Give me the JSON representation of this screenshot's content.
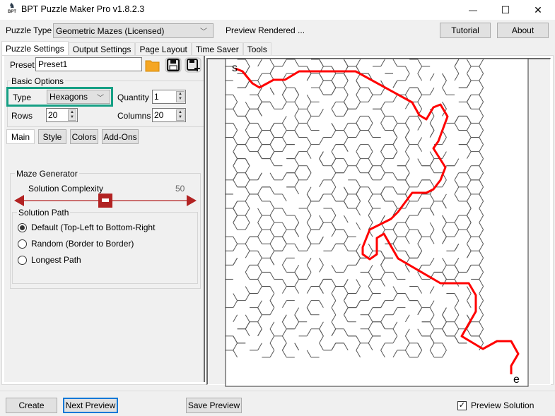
{
  "window": {
    "title": "BPT Puzzle Maker Pro v1.8.2.3",
    "app_icon_text": "BPT",
    "controls": {
      "minimize": "—",
      "maximize": "☐",
      "close": "✕"
    }
  },
  "toolbar": {
    "puzzle_type_label": "Puzzle Type",
    "puzzle_type_value": "Geometric Mazes (Licensed)",
    "status": "Preview Rendered ...",
    "tutorial_label": "Tutorial",
    "about_label": "About"
  },
  "tabs": [
    {
      "label": "Puzzle Settings",
      "active": true
    },
    {
      "label": "Output Settings",
      "active": false
    },
    {
      "label": "Page Layout",
      "active": false
    },
    {
      "label": "Time Saver",
      "active": false
    },
    {
      "label": "Tools",
      "active": false
    }
  ],
  "preset": {
    "label": "Preset",
    "value": "Preset1",
    "icons": [
      "folder-open-icon",
      "save-icon",
      "save-as-icon"
    ]
  },
  "basic_options": {
    "title": "Basic Options",
    "type_label": "Type",
    "type_value": "Hexagons",
    "quantity_label": "Quantity",
    "quantity_value": "1",
    "rows_label": "Rows",
    "rows_value": "20",
    "columns_label": "Columns",
    "columns_value": "20",
    "highlight_color": "#16a085"
  },
  "subtabs": [
    {
      "label": "Main",
      "active": true
    },
    {
      "label": "Style",
      "active": false
    },
    {
      "label": "Colors",
      "active": false
    },
    {
      "label": "Add-Ons",
      "active": false
    }
  ],
  "maze_generator": {
    "title": "Maze Generator",
    "complexity_label": "Solution Complexity",
    "complexity_value": "50",
    "complexity_fraction": 0.5,
    "slider_color": "#b22222"
  },
  "solution_path": {
    "title": "Solution Path",
    "options": [
      {
        "label": "Default (Top-Left to Bottom-Right",
        "selected": true
      },
      {
        "label": "Random (Border to Border)",
        "selected": false
      },
      {
        "label": "Longest Path",
        "selected": false
      }
    ]
  },
  "preview": {
    "start_label": "s",
    "end_label": "e",
    "solution_color": "#ff0000",
    "wall_color": "#555555"
  },
  "footer": {
    "create_label": "Create",
    "next_preview_label": "Next Preview",
    "save_preview_label": "Save Preview",
    "preview_solution_label": "Preview Solution",
    "preview_solution_checked": true
  }
}
